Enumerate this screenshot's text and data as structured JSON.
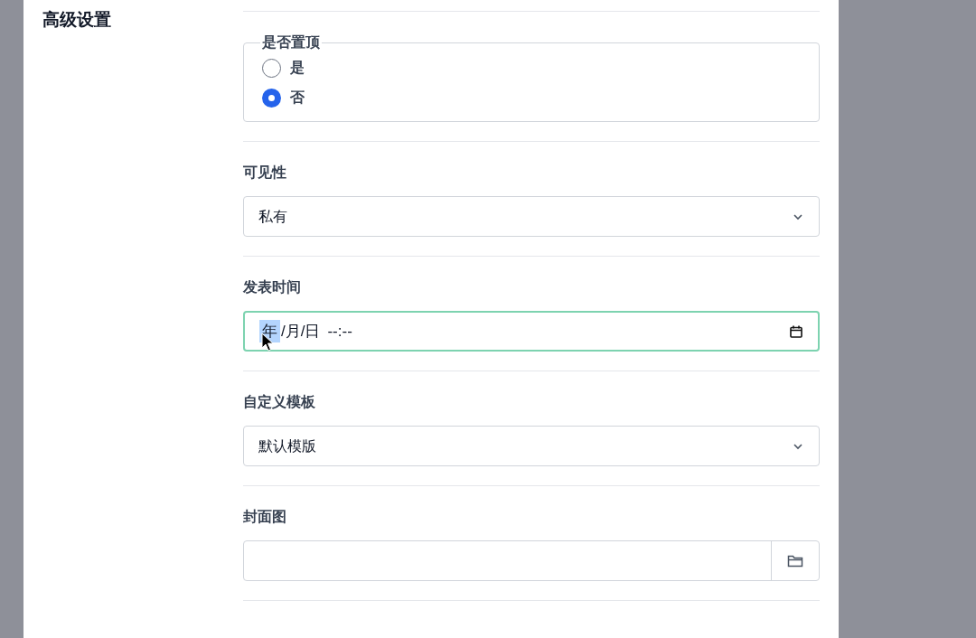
{
  "section_title": "高级设置",
  "fields": [
    {
      "kind": "radio_group",
      "legend": "是否置顶",
      "options": [
        {
          "label": "是",
          "selected": false
        },
        {
          "label": "否",
          "selected": true
        }
      ]
    },
    {
      "kind": "select",
      "label": "可见性",
      "value": "私有"
    },
    {
      "kind": "datetime",
      "label": "发表时间",
      "focused": true,
      "segments": [
        {
          "text": "年",
          "selected": true
        },
        {
          "text": "/月/日",
          "selected": false
        },
        {
          "text": "--:--",
          "selected": false
        }
      ]
    },
    {
      "kind": "select",
      "label": "自定义模板",
      "value": "默认模版"
    },
    {
      "kind": "file",
      "label": "封面图"
    }
  ]
}
